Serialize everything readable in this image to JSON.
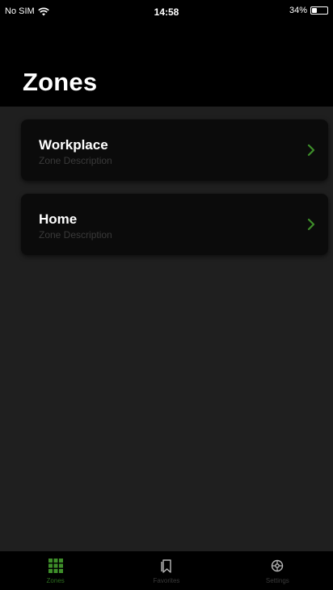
{
  "status_bar": {
    "carrier": "No SIM",
    "time": "14:58",
    "battery_label": "34%",
    "battery_level": 0.34
  },
  "header": {
    "title": "Zones"
  },
  "zones": [
    {
      "name": "Workplace",
      "description": "Zone Description"
    },
    {
      "name": "Home",
      "description": "Zone Description"
    }
  ],
  "tab_bar": {
    "tabs": [
      {
        "label": "Zones",
        "icon": "grid-icon",
        "active": true
      },
      {
        "label": "Favorites",
        "icon": "bookmark-icon",
        "active": false
      },
      {
        "label": "Settings",
        "icon": "gear-icon",
        "active": false
      }
    ]
  },
  "colors": {
    "accent": "#3e8e2a",
    "tab_active": "#2b6a1e",
    "card_bg": "#0b0b0b",
    "screen_bg": "#1f1f1f"
  }
}
